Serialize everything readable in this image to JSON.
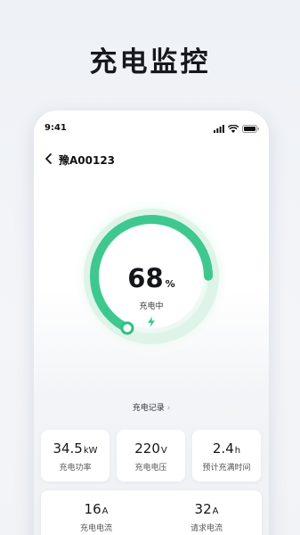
{
  "headline": "充电监控",
  "status_bar": {
    "time": "9:41"
  },
  "nav": {
    "title": "豫A00123"
  },
  "gauge": {
    "percent": "68",
    "percent_unit": "%",
    "status": "充电中",
    "progress": 0.68,
    "accent": "#3ec88f"
  },
  "record_link": {
    "label": "充电记录",
    "chevron": "›"
  },
  "stats_row1": [
    {
      "value": "34.5",
      "unit": "kW",
      "label": "充电功率"
    },
    {
      "value": "220",
      "unit": "V",
      "label": "充电电压"
    },
    {
      "value": "2.4",
      "unit": "h",
      "label": "预计充满时间"
    }
  ],
  "stats_row2": [
    {
      "value": "16",
      "unit": "A",
      "label": "充电电流"
    },
    {
      "value": "32",
      "unit": "A",
      "label": "请求电流"
    }
  ],
  "icons": [
    "back-icon",
    "signal-icon",
    "wifi-icon",
    "battery-icon",
    "bolt-icon"
  ]
}
